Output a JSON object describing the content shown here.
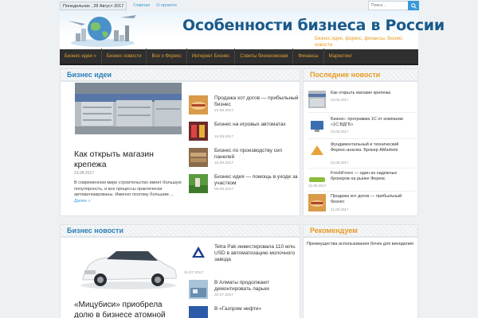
{
  "topbar": {
    "date": "Понедельник , 28 Август 2017",
    "links": [
      "Главная",
      "О проекте"
    ],
    "search_placeholder": "Поиск..."
  },
  "header": {
    "title": "Особенности бизнеса в России",
    "description": "Бизнес идеи, форекс, финансы, бизнес новости"
  },
  "nav": {
    "items": [
      "Бизнес идеи »",
      "Бизнес новости",
      "Все о Форекс",
      "Интернет Бизнес",
      "Советы бизнесменам",
      "Финансы",
      "Маркетинг"
    ]
  },
  "ideas": {
    "title": "Бизнес идеи",
    "featured": {
      "title": "Как открыть магазин крепежа",
      "date": "23.08.2017",
      "excerpt": "В современном мире строительство имеет большую популярность, и все процессы практически автоматизированы. Именно поэтому большим ...",
      "more": "Далее »"
    },
    "list": [
      {
        "title": "Продажа хот догов — прибыльный бизнес",
        "date": "21.08.2017"
      },
      {
        "title": "Бизнес на игровых автоматах",
        "date": "19.08.2017"
      },
      {
        "title": "Бизнес по производству сип панелей",
        "date": "15.08.2017"
      },
      {
        "title": "Бизнес идея — помощь в уходе за участком",
        "date": "09.08.2017"
      }
    ]
  },
  "news": {
    "title": "Бизнес новости",
    "featured": {
      "title": "«Мицубиси» приобрела долю в бизнесе атомной"
    },
    "list": [
      {
        "title": "Tetra Pak инвестировала 110 млн. USD в автоматизацию молочного завода",
        "date": "31.07.2017"
      },
      {
        "title": "В Алматы продолжают демонтировать ларьки",
        "date": "20.07.2017"
      },
      {
        "title": "В «Газпром нефти»"
      }
    ]
  },
  "sidebar": {
    "latest_title": "Последние новости",
    "latest": [
      {
        "title": "Как открыть магазин крепежа",
        "date": "23.08.2017"
      },
      {
        "title": "Бизнес- программа 1С от компании «1С:ВДГБ»",
        "date": "23.08.2017"
      },
      {
        "title": "Фундаментальный и технический Форекс-анализ. Брокер AMarkets",
        "date": "22.08.2017"
      },
      {
        "title": "FreshForex — один из надежных брокеров на рынке Форекс",
        "date": "22.08.2017"
      },
      {
        "title": "Продажа хот догов — прибыльный бизнес",
        "date": "21.08.2017"
      }
    ],
    "recommend_title": "Рекомендуем",
    "recommend_item": "Преимущества использования бочек для виноделия"
  },
  "colors": {
    "accent": "#3a9ad9",
    "title_blue": "#1a5a8a",
    "orange": "#e89b23",
    "nav_bg": "#2f2f2f"
  }
}
